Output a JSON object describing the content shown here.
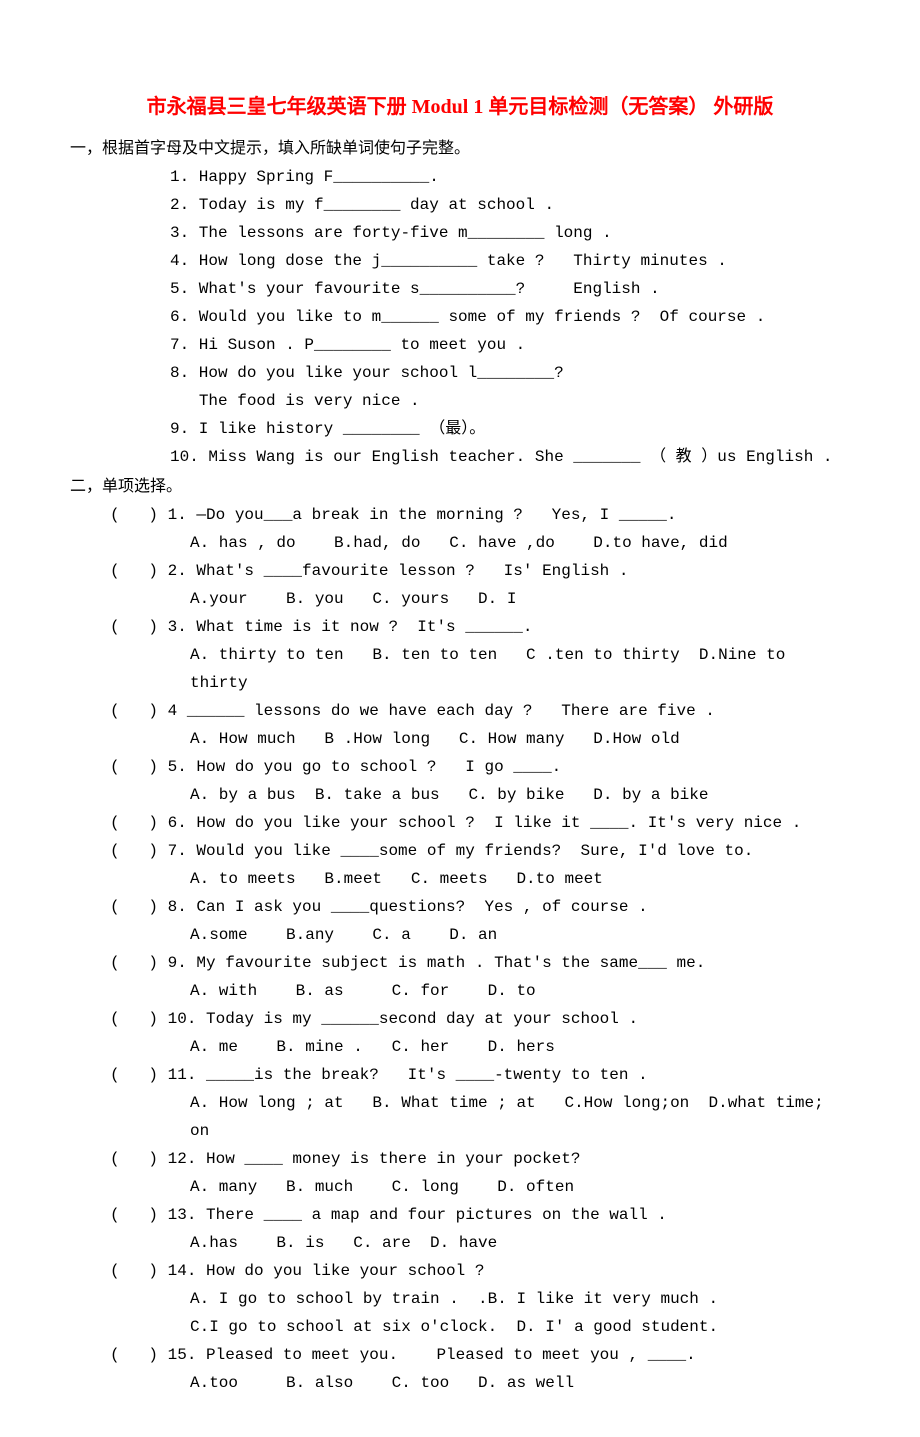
{
  "title": "市永福县三皇七年级英语下册 Modul 1 单元目标检测（无答案）  外研版",
  "section1": {
    "heading": "一，根据首字母及中文提示，填入所缺单词使句子完整。",
    "items": [
      "1. Happy Spring F__________.",
      "2. Today is my f________ day at school .",
      "3. The lessons are forty-five m________ long .",
      "4. How long dose the j__________ take ?   Thirty minutes .",
      "5. What's your favourite s__________?     English .",
      "6. Would you like to m______ some of my friends ?  Of course .",
      "7. Hi Suson . P________ to meet you .",
      "8. How do you like your school l________?\n   The food is very nice .",
      "9. I like history ________ （最）。",
      "10. Miss Wang is our English teacher. She _______ （ 教 ）us English ."
    ]
  },
  "section2": {
    "heading": "二，单项选择。",
    "items": [
      {
        "q": "(   ) 1. —Do you___a break in the morning ?   Yes, I _____.",
        "o": "A. has , do    B.had, do   C. have ,do    D.to have, did"
      },
      {
        "q": "(   ) 2. What's ____favourite lesson ?   Is' English .",
        "o": "A.your    B. you   C. yours   D. I"
      },
      {
        "q": "(   ) 3. What time is it now ?  It's ______.",
        "o": "A. thirty to ten   B. ten to ten   C .ten to thirty  D.Nine to thirty"
      },
      {
        "q": "(   ) 4 ______ lessons do we have each day ?   There are five .",
        "o": "A. How much   B .How long   C. How many   D.How old"
      },
      {
        "q": "(   ) 5. How do you go to school ?   I go ____.",
        "o": "A. by a bus  B. take a bus   C. by bike   D. by a bike"
      },
      {
        "q": "(   ) 6. How do you like your school ?  I like it ____. It's very nice .",
        "o": null
      },
      {
        "q": "(   ) 7. Would you like ____some of my friends?  Sure, I'd love to.",
        "o": "A. to meets   B.meet   C. meets   D.to meet"
      },
      {
        "q": "(   ) 8. Can I ask you ____questions?  Yes , of course .",
        "o": "A.some    B.any    C. a    D. an"
      },
      {
        "q": "(   ) 9. My favourite subject is math . That's the same___ me.",
        "o": "A. with    B. as     C. for    D. to"
      },
      {
        "q": "(   ) 10. Today is my ______second day at your school .",
        "o": "A. me    B. mine .   C. her    D. hers"
      },
      {
        "q": "(   ) 11. _____is the break?   It's ____-twenty to ten .",
        "o": "A. How long ; at   B. What time ; at   C.How long;on  D.what time; on"
      },
      {
        "q": "(   ) 12. How ____ money is there in your pocket?",
        "o": "A. many   B. much    C. long    D. often"
      },
      {
        "q": "(   ) 13. There ____ a map and four pictures on the wall .",
        "o": "A.has    B. is   C. are  D. have"
      },
      {
        "q": "(   ) 14. How do you like your school ?",
        "o": "A. I go to school by train .  .B. I like it very much .\nC.I go to school at six o'clock.  D. I' a good student."
      },
      {
        "q": "(   ) 15. Pleased to meet you.    Pleased to meet you , ____.",
        "o": "A.too     B. also    C. too   D. as well"
      }
    ]
  }
}
